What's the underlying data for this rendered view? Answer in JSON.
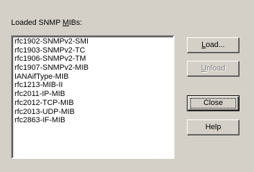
{
  "dialog": {
    "list_label_prefix": "Loaded SNMP ",
    "list_label_accel": "M",
    "list_label_suffix": "IBs:"
  },
  "mib_list": {
    "items": [
      "rfc1902-SNMPv2-SMI",
      "rfc1903-SNMPv2-TC",
      "rfc1906-SNMPv2-TM",
      "rfc1907-SNMPv2-MIB",
      "IANAifType-MIB",
      "rfc1213-MIB-II",
      "rfc2011-IP-MIB",
      "rfc2012-TCP-MIB",
      "rfc2013-UDP-MIB",
      "rfc2863-IF-MIB"
    ]
  },
  "buttons": {
    "load_accel": "L",
    "load_rest": "oad...",
    "unload_accel": "U",
    "unload_rest": "nload",
    "close": "Close",
    "help": "Help"
  }
}
